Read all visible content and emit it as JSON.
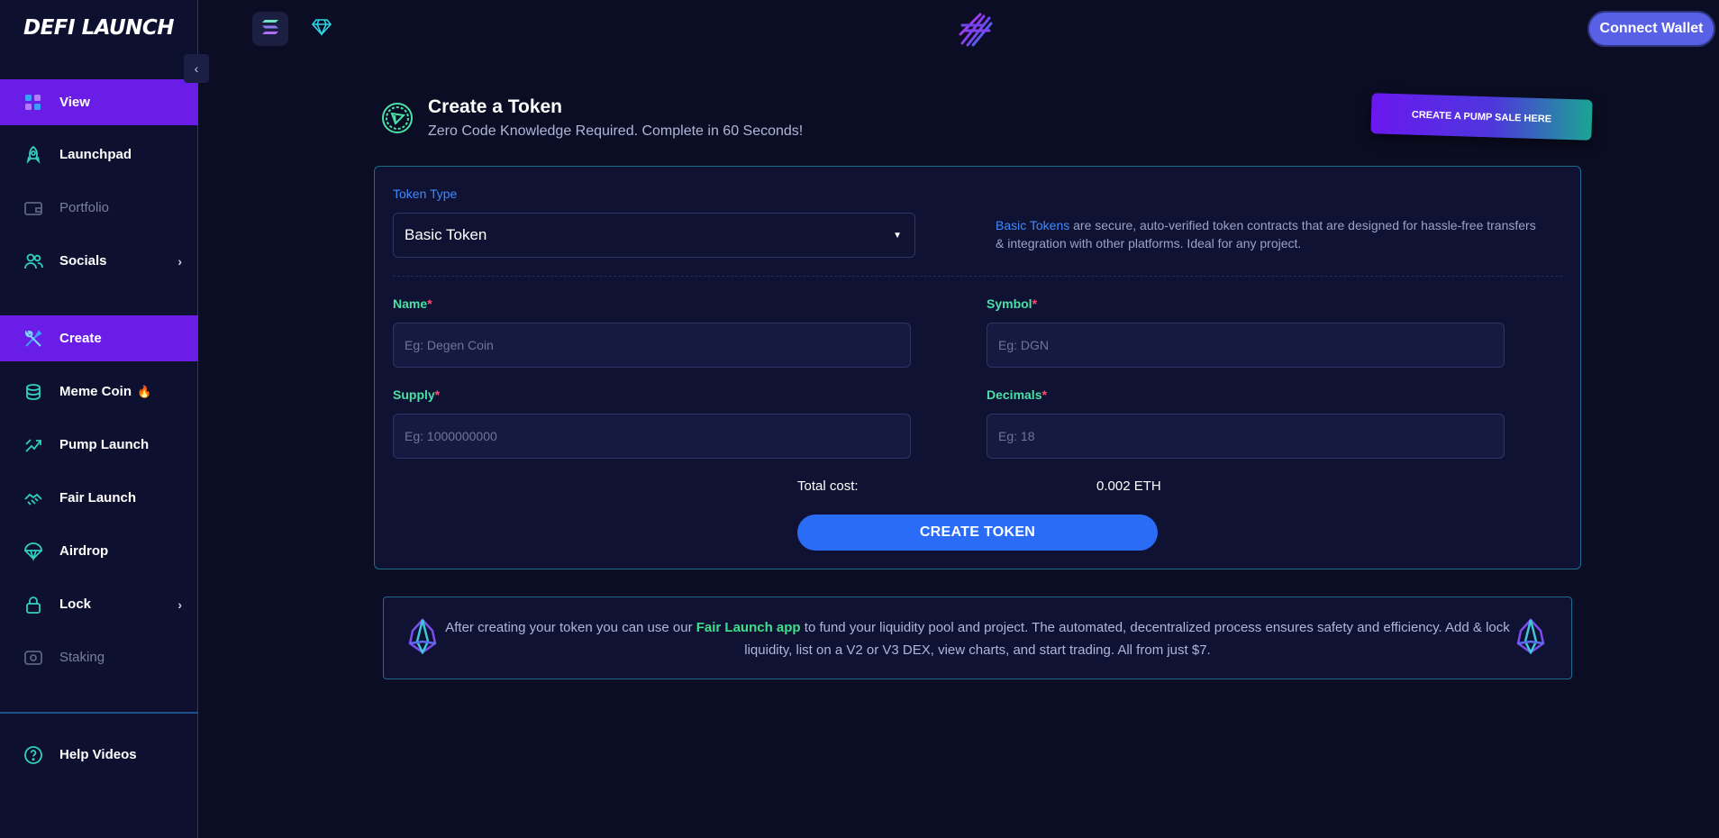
{
  "app": {
    "logo_text": "DEFI LAUNCH"
  },
  "sidebar": {
    "items": [
      {
        "label": "View",
        "icon": "grid-icon",
        "active": true
      },
      {
        "label": "Launchpad",
        "icon": "rocket-icon"
      },
      {
        "label": "Portfolio",
        "icon": "wallet-icon",
        "muted": true
      },
      {
        "label": "Socials",
        "icon": "users-icon",
        "has_submenu": true
      },
      {
        "label": "Create",
        "icon": "tools-icon",
        "active": true
      },
      {
        "label": "Meme Coin",
        "icon": "coins-icon",
        "badge": "🔥"
      },
      {
        "label": "Pump Launch",
        "icon": "pump-icon"
      },
      {
        "label": "Fair Launch",
        "icon": "fair-icon"
      },
      {
        "label": "Airdrop",
        "icon": "parachute-icon"
      },
      {
        "label": "Lock",
        "icon": "lock-icon",
        "has_submenu": true
      },
      {
        "label": "Staking",
        "icon": "staking-icon",
        "muted": true
      },
      {
        "label": "Help Videos",
        "icon": "help-icon"
      }
    ]
  },
  "header": {
    "connect_label": "Connect Wallet"
  },
  "page": {
    "title": "Create a Token",
    "subtitle": "Zero Code Knowledge Required. Complete in 60 Seconds!",
    "pump_button": "CREATE A PUMP SALE HERE"
  },
  "form": {
    "token_type_label": "Token Type",
    "token_type_value": "Basic Token",
    "info_highlight": "Basic Tokens",
    "info_rest": " are secure, auto-verified token contracts that are designed for hassle-free transfers & integration with other platforms. Ideal for any project.",
    "name_label": "Name",
    "name_placeholder": "Eg: Degen Coin",
    "symbol_label": "Symbol",
    "symbol_placeholder": "Eg: DGN",
    "supply_label": "Supply",
    "supply_placeholder": "Eg: 1000000000",
    "decimals_label": "Decimals",
    "decimals_placeholder": "Eg: 18",
    "required_mark": "*",
    "total_cost_label": "Total cost:",
    "total_cost_value": "0.002 ETH",
    "submit_label": "CREATE TOKEN"
  },
  "note": {
    "text_before": "After creating your token you can use our ",
    "link": "Fair Launch app",
    "text_after": " to fund your liquidity pool and project. The automated, decentralized process ensures safety and efficiency. Add & lock liquidity, list on a V2 or V3 DEX, view charts, and start trading. All from just $7."
  },
  "colors": {
    "background": "#0b0d24",
    "sidebar": "#0e1030",
    "active": "#6a1de6",
    "primary_button": "#2a6cf5",
    "accent_green": "#4be0a6",
    "accent_blue": "#3d8bff"
  }
}
